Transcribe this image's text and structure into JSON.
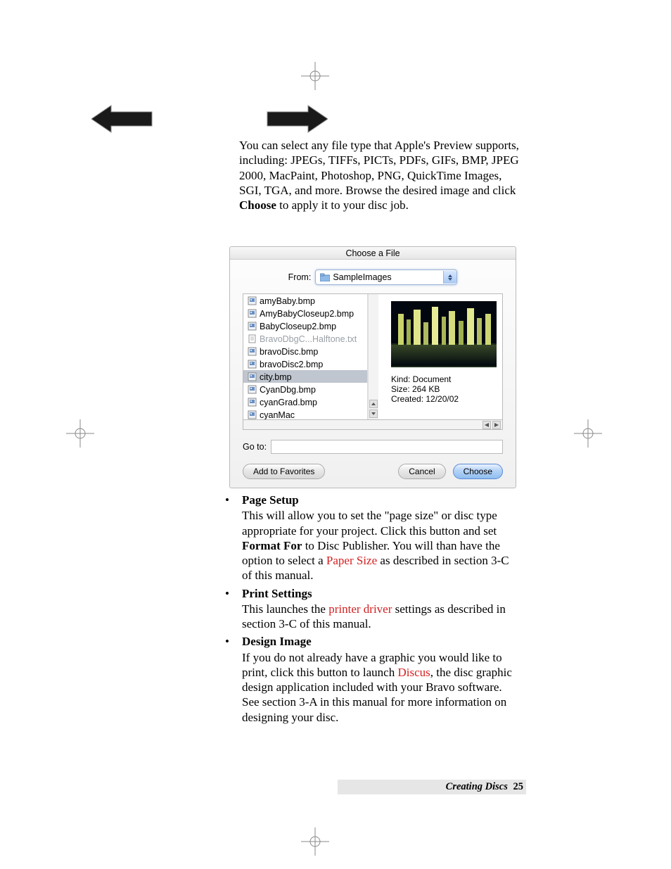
{
  "intro_text": "You can select any file type that Apple's Preview supports, including: JPEGs, TIFFs, PICTs, PDFs, GIFs, BMP, JPEG 2000, MacPaint, Photoshop, PNG, QuickTime Images, SGI, TGA, and more.  Browse the desired image and click ",
  "intro_bold": "Choose",
  "intro_tail": " to apply it to your disc job.",
  "dialog": {
    "title": "Choose a File",
    "from_label": "From:",
    "from_value": "SampleImages",
    "files": [
      {
        "name": "amyBaby.bmp",
        "type": "img",
        "selected": false
      },
      {
        "name": "AmyBabyCloseup2.bmp",
        "type": "img",
        "selected": false
      },
      {
        "name": "BabyCloseup2.bmp",
        "type": "img",
        "selected": false
      },
      {
        "name": "BravoDbgC...Halftone.txt",
        "type": "txt",
        "selected": false,
        "disabled": true
      },
      {
        "name": "bravoDisc.bmp",
        "type": "img",
        "selected": false
      },
      {
        "name": "bravoDisc2.bmp",
        "type": "img",
        "selected": false
      },
      {
        "name": "city.bmp",
        "type": "img",
        "selected": true
      },
      {
        "name": "CyanDbg.bmp",
        "type": "img",
        "selected": false
      },
      {
        "name": "cyanGrad.bmp",
        "type": "img",
        "selected": false
      },
      {
        "name": "cyanMac",
        "type": "img",
        "selected": false
      }
    ],
    "preview": {
      "kind_label": "Kind: Document",
      "size_label": "Size: 264 KB",
      "created_label": "Created: 12/20/02"
    },
    "goto_label": "Go to:",
    "add_favorites": "Add to Favorites",
    "cancel": "Cancel",
    "choose": "Choose"
  },
  "sections": {
    "page_setup": {
      "heading": "Page Setup",
      "t1": "This will allow you to set the \"page size\" or disc type appropriate for your project. Click this button and set ",
      "bold": "Format For",
      "t2": " to Disc Publisher. You will than have the option to select a ",
      "red": "Paper Size",
      "t3": " as described in section 3-C of this manual."
    },
    "print_settings": {
      "heading": "Print Settings",
      "t1": "This launches the ",
      "red": "printer driver",
      "t2": " settings as described in section 3-C of this manual."
    },
    "design_image": {
      "heading": "Design Image",
      "t1": "If you do not already have a graphic you would like to print, click this button to launch ",
      "red": "Discus",
      "t2": ", the disc graphic design application included with your Bravo software. See section 3-A in this manual for more information on designing your disc."
    }
  },
  "footer": {
    "section": "Creating Discs",
    "page": "25"
  }
}
